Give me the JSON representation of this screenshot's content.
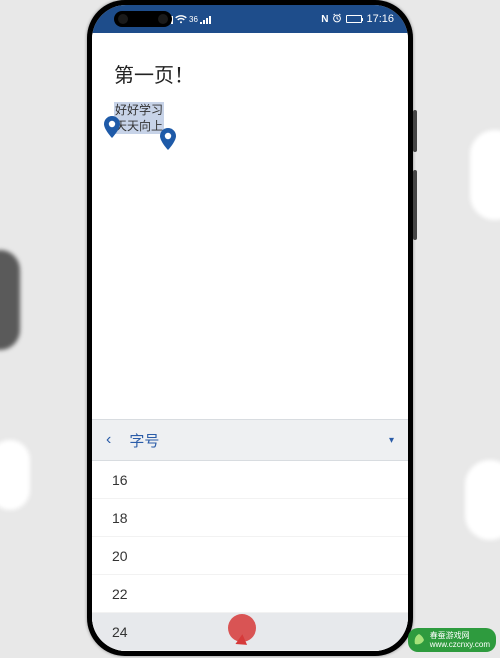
{
  "status": {
    "nfc": "N",
    "bt_icon": "bluetooth-icon",
    "time": "17:16"
  },
  "doc": {
    "title": "第一页！",
    "selected_line1": "好好学习",
    "selected_line2": "天天向上"
  },
  "panel": {
    "back": "‹",
    "title": "字号",
    "dropdown": "▾",
    "sizes": [
      "16",
      "18",
      "20",
      "22",
      "24"
    ],
    "selected": "24"
  },
  "watermark": {
    "name": "春蚕游戏网",
    "url": "www.czcnxy.com"
  }
}
